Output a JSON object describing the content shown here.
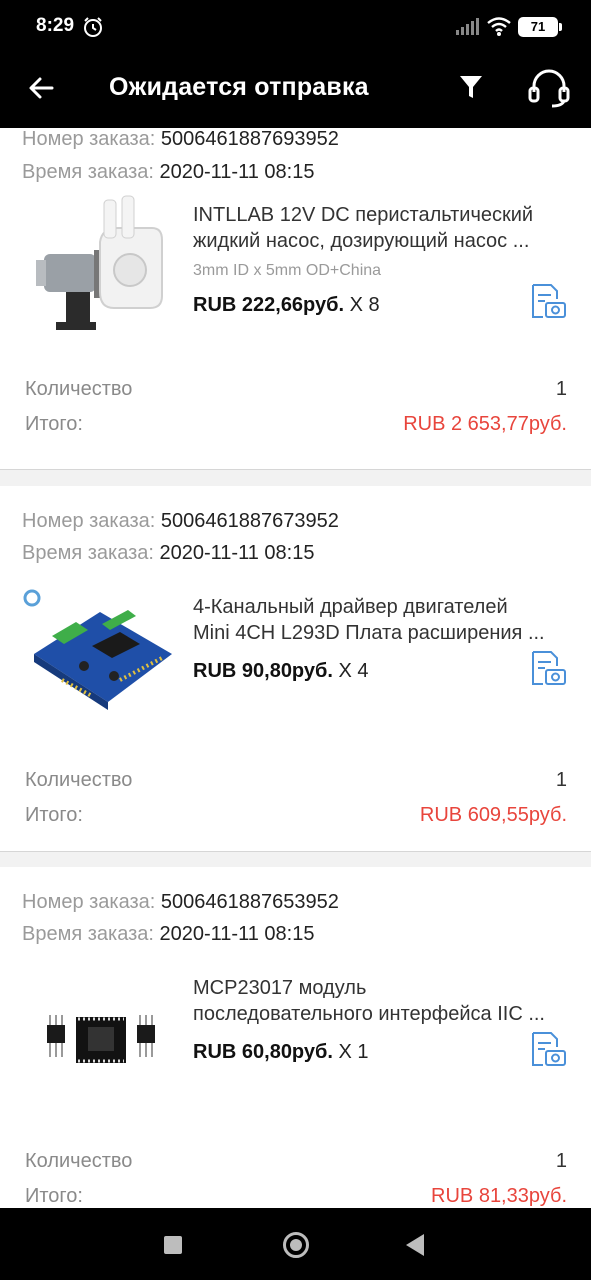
{
  "status_bar": {
    "time": "8:29",
    "battery": "71"
  },
  "header": {
    "title": "Ожидается отправка"
  },
  "labels": {
    "order_number": "Номер заказа:",
    "order_time": "Время заказа:",
    "quantity": "Количество",
    "total": "Итого:"
  },
  "orders": [
    {
      "number": "5006461887693952",
      "time": "2020-11-11 08:15",
      "title_line1": "INTLLAB 12V DC перистальтический",
      "title_line2": "жидкий насос, дозирующий насос ...",
      "variant": "3mm ID x 5mm OD+China",
      "price": "RUB 222,66руб.",
      "qty_text": "X 8",
      "quantity": "1",
      "total": "RUB 2 653,77руб."
    },
    {
      "number": "5006461887673952",
      "time": "2020-11-11 08:15",
      "title_line1": "4-Канальный драйвер двигателей",
      "title_line2": "Mini 4CH L293D Плата расширения ...",
      "variant": "",
      "price": "RUB 90,80руб.",
      "qty_text": "X 4",
      "quantity": "1",
      "total": "RUB 609,55руб."
    },
    {
      "number": "5006461887653952",
      "time": "2020-11-11 08:15",
      "title_line1": "MCP23017 модуль",
      "title_line2": "последовательного интерфейса IIC ...",
      "variant": "",
      "price": "RUB 60,80руб.",
      "qty_text": "X 1",
      "quantity": "1",
      "total": "RUB 81,33руб."
    }
  ],
  "colors": {
    "accent": "#4a90d9",
    "total_red": "#e8453c",
    "header_bg": "#000000"
  },
  "icons": [
    "back-arrow-icon",
    "filter-icon",
    "headset-icon",
    "photo-review-icon",
    "alarm-icon",
    "signal-icon",
    "wifi-icon",
    "battery-icon"
  ]
}
